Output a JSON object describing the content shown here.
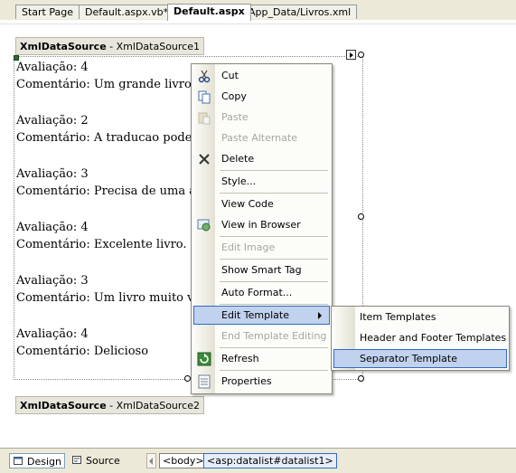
{
  "tabs": [
    {
      "label": "Start Page",
      "active": false
    },
    {
      "label": "Default.aspx.vb*",
      "active": false
    },
    {
      "label": "Default.aspx",
      "active": true
    },
    {
      "label": "App_Data/Livros.xml",
      "active": false
    }
  ],
  "datasource1": {
    "type": "XmlDataSource",
    "name": " - XmlDataSource1"
  },
  "datasource2": {
    "type": "XmlDataSource",
    "name": " - XmlDataSource2"
  },
  "items": [
    {
      "rating": "Avaliação: 4",
      "comment": "Comentário: Um grande livro."
    },
    {
      "rating": "Avaliação: 2",
      "comment": "Comentário: A traducao poderia"
    },
    {
      "rating": "Avaliação: 3",
      "comment": "Comentário: Precisa de uma atua"
    },
    {
      "rating": "Avaliação: 4",
      "comment": "Comentário: Excelente livro."
    },
    {
      "rating": "Avaliação: 3",
      "comment": "Comentário: Um livro muito valio"
    },
    {
      "rating": "Avaliação: 4",
      "comment": "Comentário: Delicioso"
    }
  ],
  "context_menu": {
    "cut": "Cut",
    "copy": "Copy",
    "paste": "Paste",
    "paste_alternate": "Paste Alternate",
    "delete": "Delete",
    "style": "Style...",
    "view_code": "View Code",
    "view_in_browser": "View in Browser",
    "edit_image": "Edit Image",
    "show_smart_tag": "Show Smart Tag",
    "auto_format": "Auto Format...",
    "edit_template": "Edit Template",
    "end_template_editing": "End Template Editing",
    "refresh": "Refresh",
    "properties": "Properties"
  },
  "submenu": {
    "item_templates": "Item Templates",
    "header_footer_templates": "Header and Footer Templates",
    "separator_template": "Separator Template"
  },
  "bottom_bar": {
    "design": "Design",
    "source": "Source",
    "crumb_body": "<body>",
    "crumb_datalist": "<asp:datalist#datalist1>"
  },
  "colors": {
    "menu_highlight": "#c1d2ee",
    "menu_highlight_border": "#316ac5",
    "disabled_text": "#a7a69c"
  }
}
